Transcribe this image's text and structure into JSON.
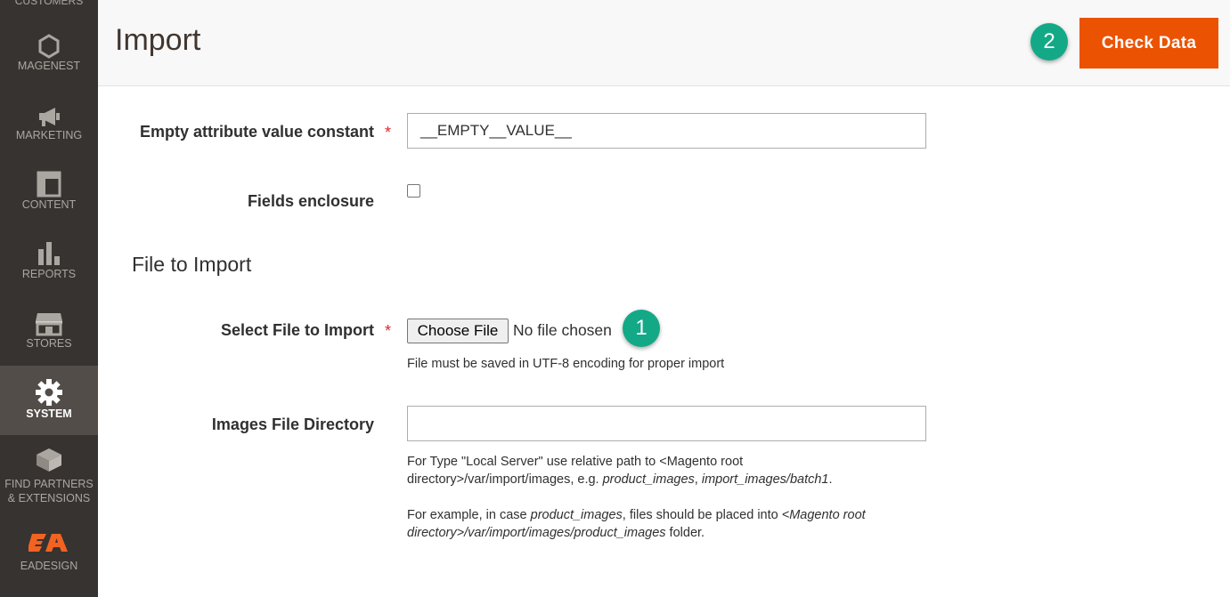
{
  "sidebar": {
    "partial_item": "CUSTOMERS",
    "items": [
      {
        "label": "MAGENEST",
        "icon": "hexagon-icon"
      },
      {
        "label": "MARKETING",
        "icon": "megaphone-icon"
      },
      {
        "label": "CONTENT",
        "icon": "layout-icon"
      },
      {
        "label": "REPORTS",
        "icon": "bar-chart-icon"
      },
      {
        "label": "STORES",
        "icon": "storefront-icon"
      },
      {
        "label": "SYSTEM",
        "icon": "gear-icon"
      },
      {
        "label_line1": "FIND PARTNERS",
        "label_line2": "& EXTENSIONS",
        "icon": "blocks-icon"
      },
      {
        "label": "EADESIGN",
        "icon": "eadesign-logo-icon"
      }
    ]
  },
  "header": {
    "title": "Import",
    "check_data_label": "Check Data",
    "badge_2": "2"
  },
  "form": {
    "empty_attr_label": "Empty attribute value constant",
    "empty_attr_value": "__EMPTY__VALUE__",
    "fields_enclosure_label": "Fields enclosure",
    "section_title": "File to Import",
    "select_file_label": "Select File to Import",
    "choose_file_label": "Choose File",
    "no_file_text": "No file chosen",
    "badge_1": "1",
    "utf8_note": "File must be saved in UTF-8 encoding for proper import",
    "images_dir_label": "Images File Directory",
    "images_dir_value": "",
    "note1_part1": "For Type \"Local Server\" use relative path to <Magento root",
    "note1_part2": "directory>/var/import/images, e.g. ",
    "note1_ex1": "product_images",
    "note1_sep": ", ",
    "note1_ex2": "import_images/batch1",
    "note1_end": ".",
    "note2_part1": "For example, in case ",
    "note2_ex1": "product_images",
    "note2_part2": ", files should be placed into ",
    "note2_ex2a": "<Magento root",
    "note2_ex2b": "directory>/var/import/images/product_images",
    "note2_end": " folder."
  },
  "colors": {
    "sidebar_bg": "#373330",
    "accent": "#eb5202",
    "badge": "#13a987",
    "required": "#e22626"
  }
}
